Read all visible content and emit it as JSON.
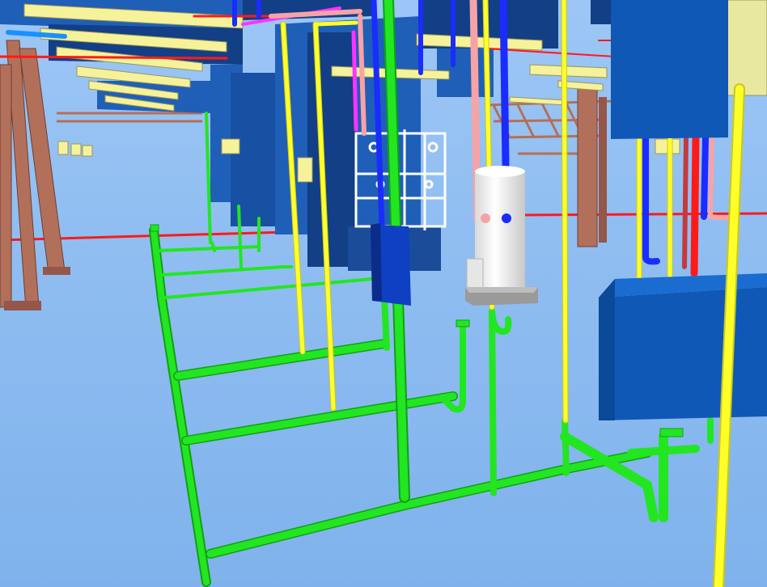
{
  "scene": {
    "kind": "3D BIM model view of plumbing, ductwork and structure",
    "colors": {
      "sky": "#9cc6f5",
      "floor": "#7fb2ec",
      "drain_pipe": "#22e622",
      "drain_pipe_dark": "#11a011",
      "cold_water_pipe": "#ffff2a",
      "hot_water_pipe": "#f7a3a6",
      "blue_pipe": "#1a2cff",
      "red_pipe": "#ff1a1a",
      "magenta_pipe": "#ff33ff",
      "duct": "#1f5fb8",
      "duct_dark": "#123f85",
      "structure_steel": "#b2705a",
      "light_fixture": "#f6f29a",
      "water_heater": "#f2f2f2",
      "equipment_box": "#0f58b5"
    },
    "objects": [
      {
        "name": "drain-pipe-network",
        "color_key": "drain_pipe"
      },
      {
        "name": "cold-water-risers",
        "color_key": "cold_water_pipe"
      },
      {
        "name": "hot-water-pipes",
        "color_key": "hot_water_pipe"
      },
      {
        "name": "overhead-ductwork",
        "color_key": "duct"
      },
      {
        "name": "structural-columns",
        "color_key": "structure_steel"
      },
      {
        "name": "ceiling-light-fixtures",
        "color_key": "light_fixture"
      },
      {
        "name": "water-heater-tank",
        "color_key": "water_heater"
      },
      {
        "name": "equipment-box",
        "color_key": "equipment_box"
      }
    ]
  }
}
